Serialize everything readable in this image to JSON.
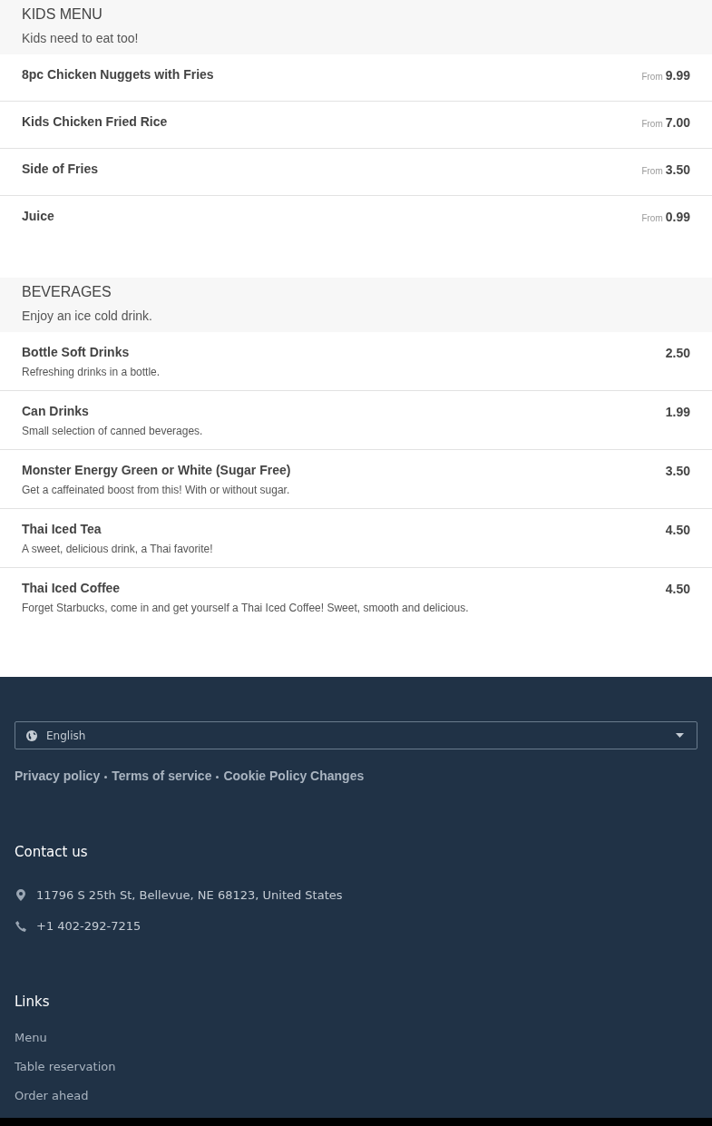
{
  "sections": [
    {
      "title": "KIDS MENU",
      "subtitle": "Kids need to eat too!",
      "items": [
        {
          "name": "8pc Chicken Nuggets with Fries",
          "price_prefix": "From",
          "price": "9.99"
        },
        {
          "name": "Kids Chicken Fried Rice",
          "price_prefix": "From",
          "price": "7.00"
        },
        {
          "name": "Side of Fries",
          "price_prefix": "From",
          "price": "3.50"
        },
        {
          "name": "Juice",
          "price_prefix": "From",
          "price": "0.99"
        }
      ]
    },
    {
      "title": "BEVERAGES",
      "subtitle": "Enjoy an ice cold drink.",
      "items": [
        {
          "name": "Bottle Soft Drinks",
          "description": "Refreshing drinks in a bottle.",
          "price": "2.50"
        },
        {
          "name": "Can Drinks",
          "description": "Small selection of canned beverages.",
          "price": "1.99"
        },
        {
          "name": "Monster Energy Green or White (Sugar Free)",
          "description": "Get a caffeinated boost from this! With or without sugar.",
          "price": "3.50"
        },
        {
          "name": "Thai Iced Tea",
          "description": "A sweet, delicious drink, a Thai favorite!",
          "price": "4.50"
        },
        {
          "name": "Thai Iced Coffee",
          "description": "Forget Starbucks, come in and get yourself a Thai Iced Coffee! Sweet, smooth and delicious.",
          "price": "4.50"
        }
      ]
    }
  ],
  "footer": {
    "language": "English",
    "legal_links": [
      "Privacy policy",
      "Terms of service",
      "Cookie Policy Changes"
    ],
    "contact": {
      "title": "Contact us",
      "address": "11796 S 25th St, Bellevue, NE 68123, United States",
      "phone": "+1 402-292-7215"
    },
    "links": {
      "title": "Links",
      "items": [
        "Menu",
        "Table reservation",
        "Order ahead"
      ]
    }
  }
}
